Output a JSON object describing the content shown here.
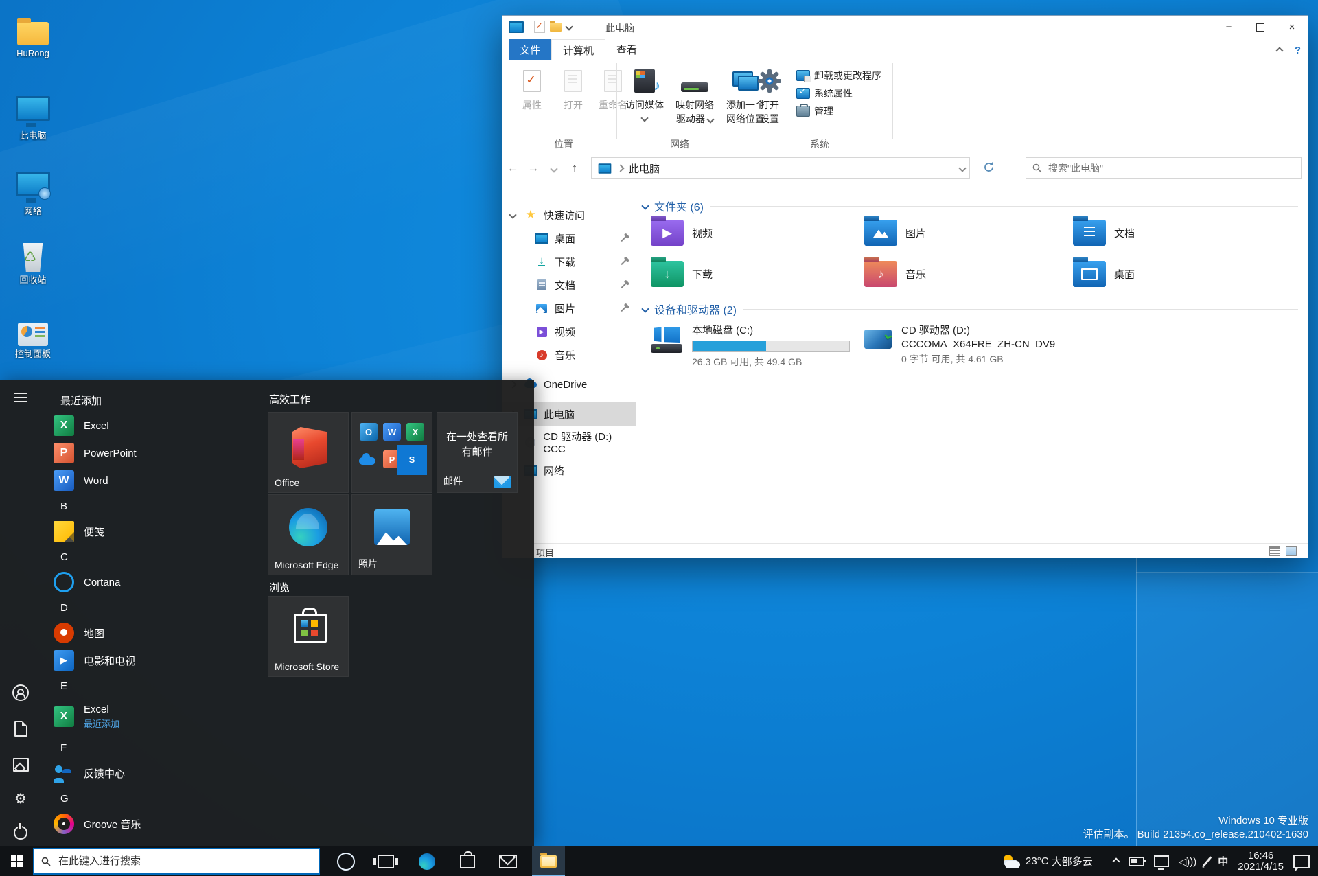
{
  "desktop": {
    "icons": [
      {
        "label": "HuRong"
      },
      {
        "label": "此电脑"
      },
      {
        "label": "网络"
      },
      {
        "label": "回收站"
      },
      {
        "label": "控制面板"
      }
    ],
    "watermark": {
      "line1": "Windows 10 专业版",
      "line2": "评估副本。  Build 21354.co_release.210402-1630"
    }
  },
  "explorer": {
    "title": "此电脑",
    "tabs": [
      {
        "label": "文件"
      },
      {
        "label": "计算机"
      },
      {
        "label": "查看"
      }
    ],
    "ribbon": {
      "loc": {
        "b1": "属性",
        "b2": "打开",
        "b3": "重命名",
        "group": "位置"
      },
      "net": {
        "b1": "访问媒体",
        "b2a": "映射网络",
        "b2b": "驱动器",
        "b3a": "添加一个",
        "b3b": "网络位置",
        "group": "网络"
      },
      "sys": {
        "b1a": "打开",
        "b1b": "设置",
        "s1": "卸载或更改程序",
        "s2": "系统属性",
        "s3": "管理",
        "group": "系统"
      }
    },
    "address": {
      "crumb": "此电脑",
      "search_placeholder": "搜索\"此电脑\""
    },
    "nav": [
      {
        "label": "快速访问"
      },
      {
        "label": "桌面"
      },
      {
        "label": "下载"
      },
      {
        "label": "文档"
      },
      {
        "label": "图片"
      },
      {
        "label": "视频"
      },
      {
        "label": "音乐"
      },
      {
        "label": "OneDrive"
      },
      {
        "label": "此电脑"
      },
      {
        "label": "CD 驱动器 (D:) CCC"
      },
      {
        "label": "网络"
      }
    ],
    "sections": {
      "folders": "文件夹 (6)",
      "devices": "设备和驱动器 (2)"
    },
    "folders": [
      "视频",
      "图片",
      "文档",
      "下载",
      "音乐",
      "桌面"
    ],
    "drive_c": {
      "name": "本地磁盘 (C:)",
      "detail": "26.3 GB 可用, 共 49.4 GB",
      "used_percent": 47
    },
    "drive_d": {
      "line1": "CD 驱动器 (D:)",
      "line2": "CCCOMA_X64FRE_ZH-CN_DV9",
      "detail": "0 字节 可用, 共 4.61 GB"
    },
    "status": {
      "items_text": "项目"
    }
  },
  "start_menu": {
    "apps": [
      {
        "kind": "header",
        "label": "最近添加"
      },
      {
        "kind": "app",
        "label": "Excel"
      },
      {
        "kind": "app",
        "label": "PowerPoint"
      },
      {
        "kind": "app",
        "label": "Word"
      },
      {
        "kind": "header",
        "label": "B"
      },
      {
        "kind": "app",
        "label": "便笺"
      },
      {
        "kind": "header",
        "label": "C"
      },
      {
        "kind": "app",
        "label": "Cortana"
      },
      {
        "kind": "header",
        "label": "D"
      },
      {
        "kind": "app",
        "label": "地图"
      },
      {
        "kind": "app",
        "label": "电影和电视"
      },
      {
        "kind": "header",
        "label": "E"
      },
      {
        "kind": "app",
        "label": "Excel",
        "sub": "最近添加"
      },
      {
        "kind": "header",
        "label": "F"
      },
      {
        "kind": "app",
        "label": "反馈中心"
      },
      {
        "kind": "header",
        "label": "G"
      },
      {
        "kind": "app",
        "label": "Groove 音乐"
      },
      {
        "kind": "header",
        "label": "H"
      }
    ],
    "groups": [
      {
        "title": "高效工作"
      },
      {
        "title": "浏览"
      }
    ],
    "tiles": {
      "office": "Office",
      "mail_line": "在一处查看所有邮件",
      "mail_label": "邮件",
      "edge": "Microsoft Edge",
      "photos": "照片",
      "store": "Microsoft Store"
    }
  },
  "taskbar": {
    "search_placeholder": "在此键入进行搜索",
    "weather_temp": "23°C",
    "weather_desc": "大部多云",
    "ime": "中",
    "time": "16:46",
    "date": "2021/4/15"
  }
}
